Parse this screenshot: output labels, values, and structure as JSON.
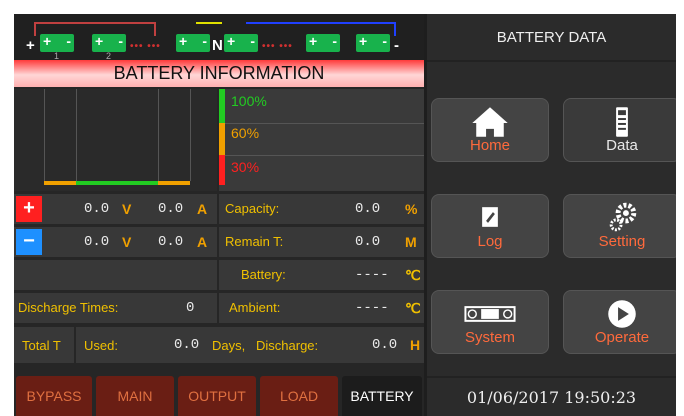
{
  "header": {
    "title": "BATTERY DATA"
  },
  "info_title": "BATTERY INFORMATION",
  "battery_strip": {
    "cells": [
      {
        "plus": "+",
        "minus": "-",
        "sub": "1"
      },
      {
        "plus": "+",
        "minus": "-",
        "sub": "2"
      },
      {
        "plus": "+",
        "minus": "-",
        "sub": ""
      },
      {
        "plus": "+",
        "minus": "-",
        "sub": ""
      },
      {
        "plus": "+",
        "minus": "-",
        "sub": ""
      },
      {
        "plus": "+",
        "minus": "-",
        "sub": ""
      }
    ],
    "neutral": "N",
    "plus_terminal": "+",
    "minus_terminal": "-"
  },
  "levels": {
    "high": "100%",
    "mid": "60%",
    "low": "30%"
  },
  "positive": {
    "sign": "+",
    "voltage": "0.0",
    "voltage_unit": "V",
    "current": "0.0",
    "current_unit": "A"
  },
  "negative": {
    "sign": "−",
    "voltage": "0.0",
    "voltage_unit": "V",
    "current": "0.0",
    "current_unit": "A"
  },
  "capacity": {
    "label": "Capacity:",
    "value": "0.0",
    "unit": "%"
  },
  "remain": {
    "label": "Remain T:",
    "value": "0.0",
    "unit": "M"
  },
  "battery_temp": {
    "label": "Battery:",
    "value": "----",
    "unit": "℃"
  },
  "ambient_temp": {
    "label": "Ambient:",
    "value": "----",
    "unit": "℃"
  },
  "discharge": {
    "label": "Discharge Times:",
    "value": "0"
  },
  "totals": {
    "label": "Total T",
    "used_label": "Used:",
    "used_value": "0.0",
    "days_label": "Days,",
    "discharge_label": "Discharge:",
    "discharge_value": "0.0",
    "discharge_unit": "H"
  },
  "tabs": [
    "BYPASS",
    "MAIN",
    "OUTPUT",
    "LOAD",
    "BATTERY"
  ],
  "buttons": {
    "home": "Home",
    "data": "Data",
    "log": "Log",
    "setting": "Setting",
    "system": "System",
    "operate": "Operate"
  },
  "datetime": "01/06/2017 19:50:23",
  "colors": {
    "accent_red": "#ff2020",
    "bar_green": "#22cc22",
    "bar_orange": "#f0a000",
    "label_yellow": "#f0c000",
    "btn_red_text": "#ff6a3c"
  }
}
